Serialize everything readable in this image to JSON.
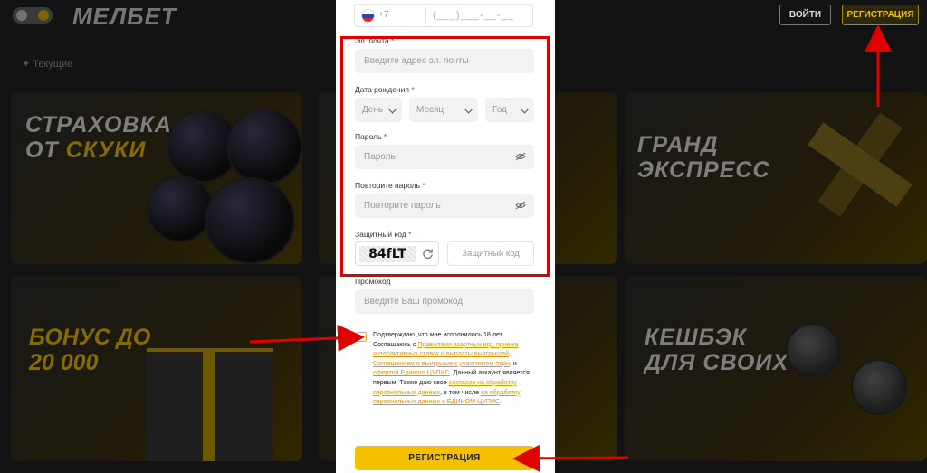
{
  "header": {
    "logo": "МЕЛБЕТ",
    "login_label": "ВОЙТИ",
    "register_label": "РЕГИСТРАЦИЯ"
  },
  "background": {
    "current_label": "Текущие",
    "cards": [
      {
        "line1": "СТРАХОВКА",
        "line2_white": "ОТ ",
        "line2_yellow": "СКУКИ"
      },
      {
        "line1": "ГРАНД",
        "line2": "ЭКСПРЕСС"
      },
      {
        "line1": "БОНУС ДО",
        "line2": "20 000"
      },
      {
        "line1": "КЕШБЭК",
        "line2": "ДЛЯ СВОИХ"
      }
    ]
  },
  "form": {
    "phone_code": "+7",
    "phone_mask": "(___)___-__-__",
    "email_label": "Эл. почта",
    "email_placeholder": "Введите адрес эл. почты",
    "birth_label": "Дата рождения",
    "day_placeholder": "День",
    "month_placeholder": "Месяц",
    "year_placeholder": "Год",
    "password_label": "Пароль",
    "password_placeholder": "Пароль",
    "repeat_label": "Повторите пароль",
    "repeat_placeholder": "Повторите пароль",
    "captcha_label": "Защитный код",
    "captcha_text": "84fLT",
    "captcha_placeholder": "Защитный код",
    "promo_label": "Промокод",
    "promo_placeholder": "Введите Ваш промокод",
    "required_mark": "*",
    "terms": {
      "t1": "Подтверждаю ,что мне исполнилось 18 лет. Соглашаюсь с ",
      "l1": "Правилами азартных игр, приема интерактивных ставок и выплаты выигрышей",
      "t2": ", ",
      "l2": "Соглашением о выигрыше с участником пари",
      "t3": ", и ",
      "l3": "офертой Единого ЦУПИС",
      "t4": ". Данный аккаунт является первым. Также даю свое ",
      "l4": "согласие на обработку персональных данных",
      "t5": ", в том числе ",
      "l5": "на обработку персональных данных в ЕДИНОМ ЦУПИС",
      "t6": "."
    },
    "submit_label": "РЕГИСТРАЦИЯ"
  },
  "colors": {
    "accent": "#f5c000",
    "annotation": "#e00000",
    "link": "#e09400"
  }
}
